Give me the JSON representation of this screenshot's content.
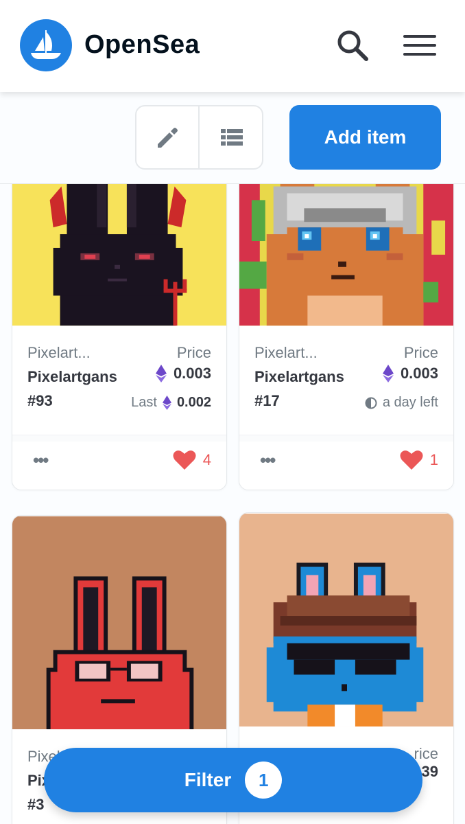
{
  "header": {
    "brand": "OpenSea",
    "logo_icon": "opensea-boat-logo",
    "search_icon": "search-icon",
    "menu_icon": "hamburger-menu-icon"
  },
  "toolbar": {
    "edit_icon": "pencil-icon",
    "list_icon": "list-view-icon",
    "add_item_label": "Add item"
  },
  "cards": [
    {
      "collection": "Pixelart...",
      "name": "Pixelartgans",
      "number": "#93",
      "price_label": "Price",
      "price": "0.003",
      "sub_label": "Last",
      "sub_value": "0.002",
      "likes": "4",
      "image_bg": "#f7e25a"
    },
    {
      "collection": "Pixelart...",
      "name": "Pixelartgans",
      "number": "#17",
      "price_label": "Price",
      "price": "0.003",
      "sub_label": "a day left",
      "likes": "1",
      "image_bg": "#e8d84a"
    },
    {
      "collection": "Pixel",
      "name": "Pix",
      "number": "#3",
      "image_bg": "#c28660"
    },
    {
      "price_label": "rice",
      "price": "39",
      "image_bg": "#e8b48e"
    }
  ],
  "filter": {
    "label": "Filter",
    "count": "1"
  },
  "colors": {
    "accent": "#2081e2",
    "heart": "#eb5757",
    "eth": "#6c47c9"
  }
}
